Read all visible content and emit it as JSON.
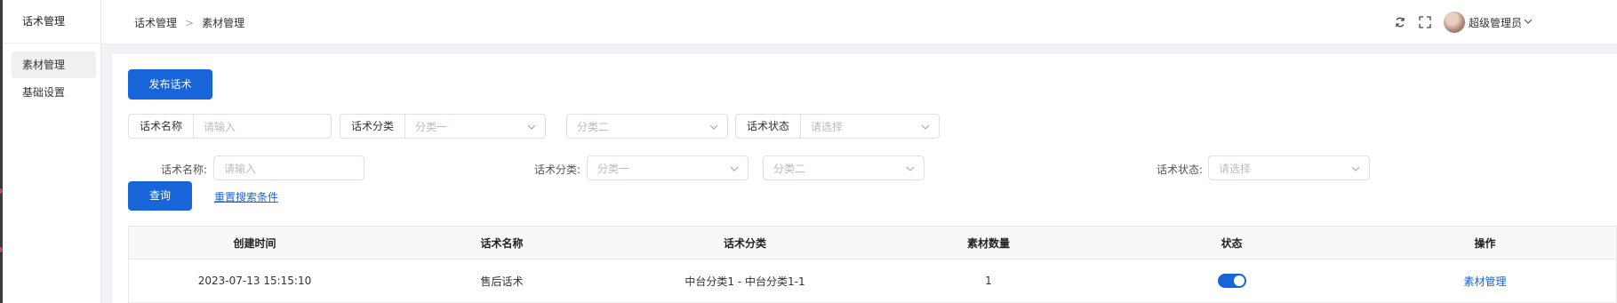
{
  "sidebar": {
    "title": "话术管理",
    "items": [
      {
        "label": "素材管理",
        "active": true
      },
      {
        "label": "基础设置",
        "active": false
      }
    ]
  },
  "header": {
    "breadcrumb": [
      "话术管理",
      "素材管理"
    ],
    "user_name": "超级管理员",
    "icons": [
      "refresh-icon",
      "fullscreen-icon",
      "avatar",
      "chevron-down-icon"
    ]
  },
  "toolbar": {
    "publish_label": "发布话术"
  },
  "filter_row1": {
    "name_label": "话术名称",
    "name_placeholder": "请输入",
    "category_label": "话术分类",
    "category1_placeholder": "分类一",
    "category2_placeholder": "分类二",
    "status_label": "话术状态",
    "status_placeholder": "请选择"
  },
  "filter_row2": {
    "name_label": "话术名称:",
    "name_placeholder": "请输入",
    "category_label": "话术分类:",
    "category1_placeholder": "分类一",
    "category2_placeholder": "分类二",
    "status_label": "话术状态:",
    "status_placeholder": "请选择",
    "query_label": "查询",
    "reset_label": "重置搜索条件"
  },
  "table": {
    "columns": [
      "创建时间",
      "话术名称",
      "话术分类",
      "素材数量",
      "状态",
      "操作"
    ],
    "rows": [
      {
        "created": "2023-07-13 15:15:10",
        "name": "售后话术",
        "category": "中台分类1 - 中台分类1-1",
        "count": "1",
        "status_on": true,
        "action": "素材管理"
      }
    ]
  },
  "colors": {
    "primary": "#1765d8",
    "background": "#f0f2f5"
  }
}
